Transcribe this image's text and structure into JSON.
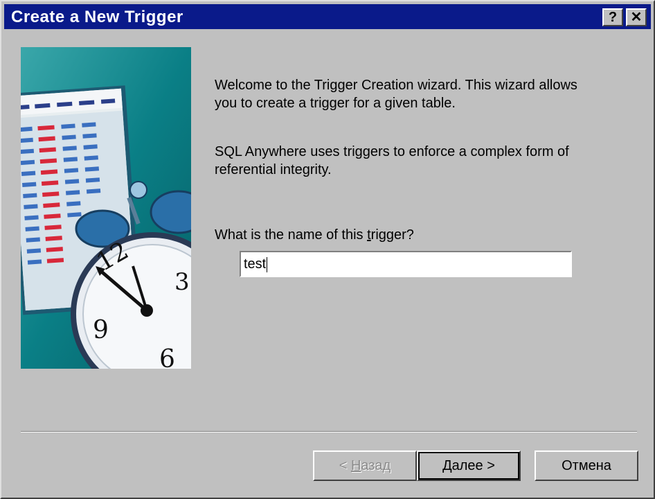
{
  "window": {
    "title": "Create a New Trigger",
    "help_label": "?",
    "close_label": "✕"
  },
  "intro": {
    "welcome": "Welcome to the Trigger Creation wizard.  This wizard allows you to create a trigger for a given table.",
    "sql_anywhere": "SQL Anywhere uses triggers to enforce a complex form of referential integrity."
  },
  "question": {
    "before": "What is the name of this ",
    "accel": "t",
    "after": "rigger?"
  },
  "name_field": {
    "value": "test"
  },
  "buttons": {
    "back": {
      "prefix": "< ",
      "accel": "Н",
      "rest": "азад"
    },
    "next": "Далее >",
    "cancel": "Отмена"
  },
  "colors": {
    "titlebar": "#0a1a8a",
    "face": "#c0c0c0",
    "art_bg": "#0a7f86"
  },
  "icons": [
    "help-icon",
    "close-icon",
    "calendar-clock-illustration"
  ]
}
